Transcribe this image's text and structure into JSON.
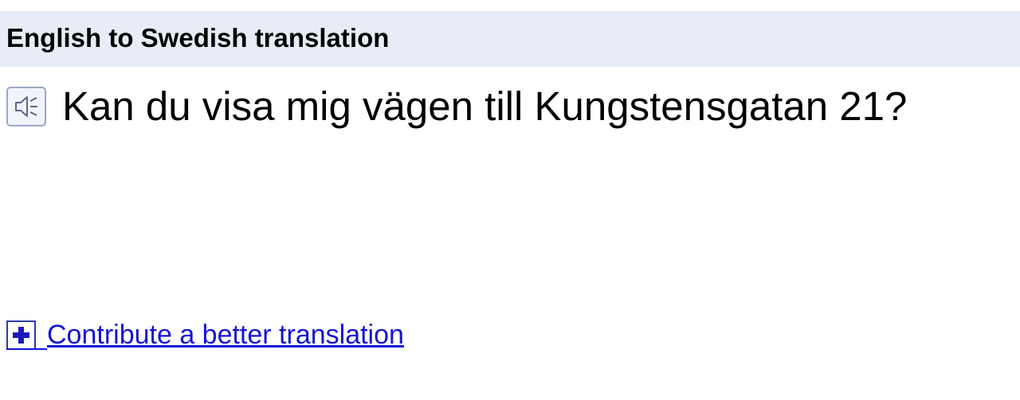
{
  "header": {
    "title": "English to Swedish translation"
  },
  "result": {
    "speaker_icon": "speaker-icon",
    "text": "Kan du visa mig vägen till Kungstensgatan 21?"
  },
  "contribute": {
    "icon": "plus-icon",
    "label": "Contribute a better translation"
  },
  "colors": {
    "header_bg": "#e8ecf6",
    "link": "#1414d6",
    "plus_icon_border": "#2a3ba8"
  }
}
